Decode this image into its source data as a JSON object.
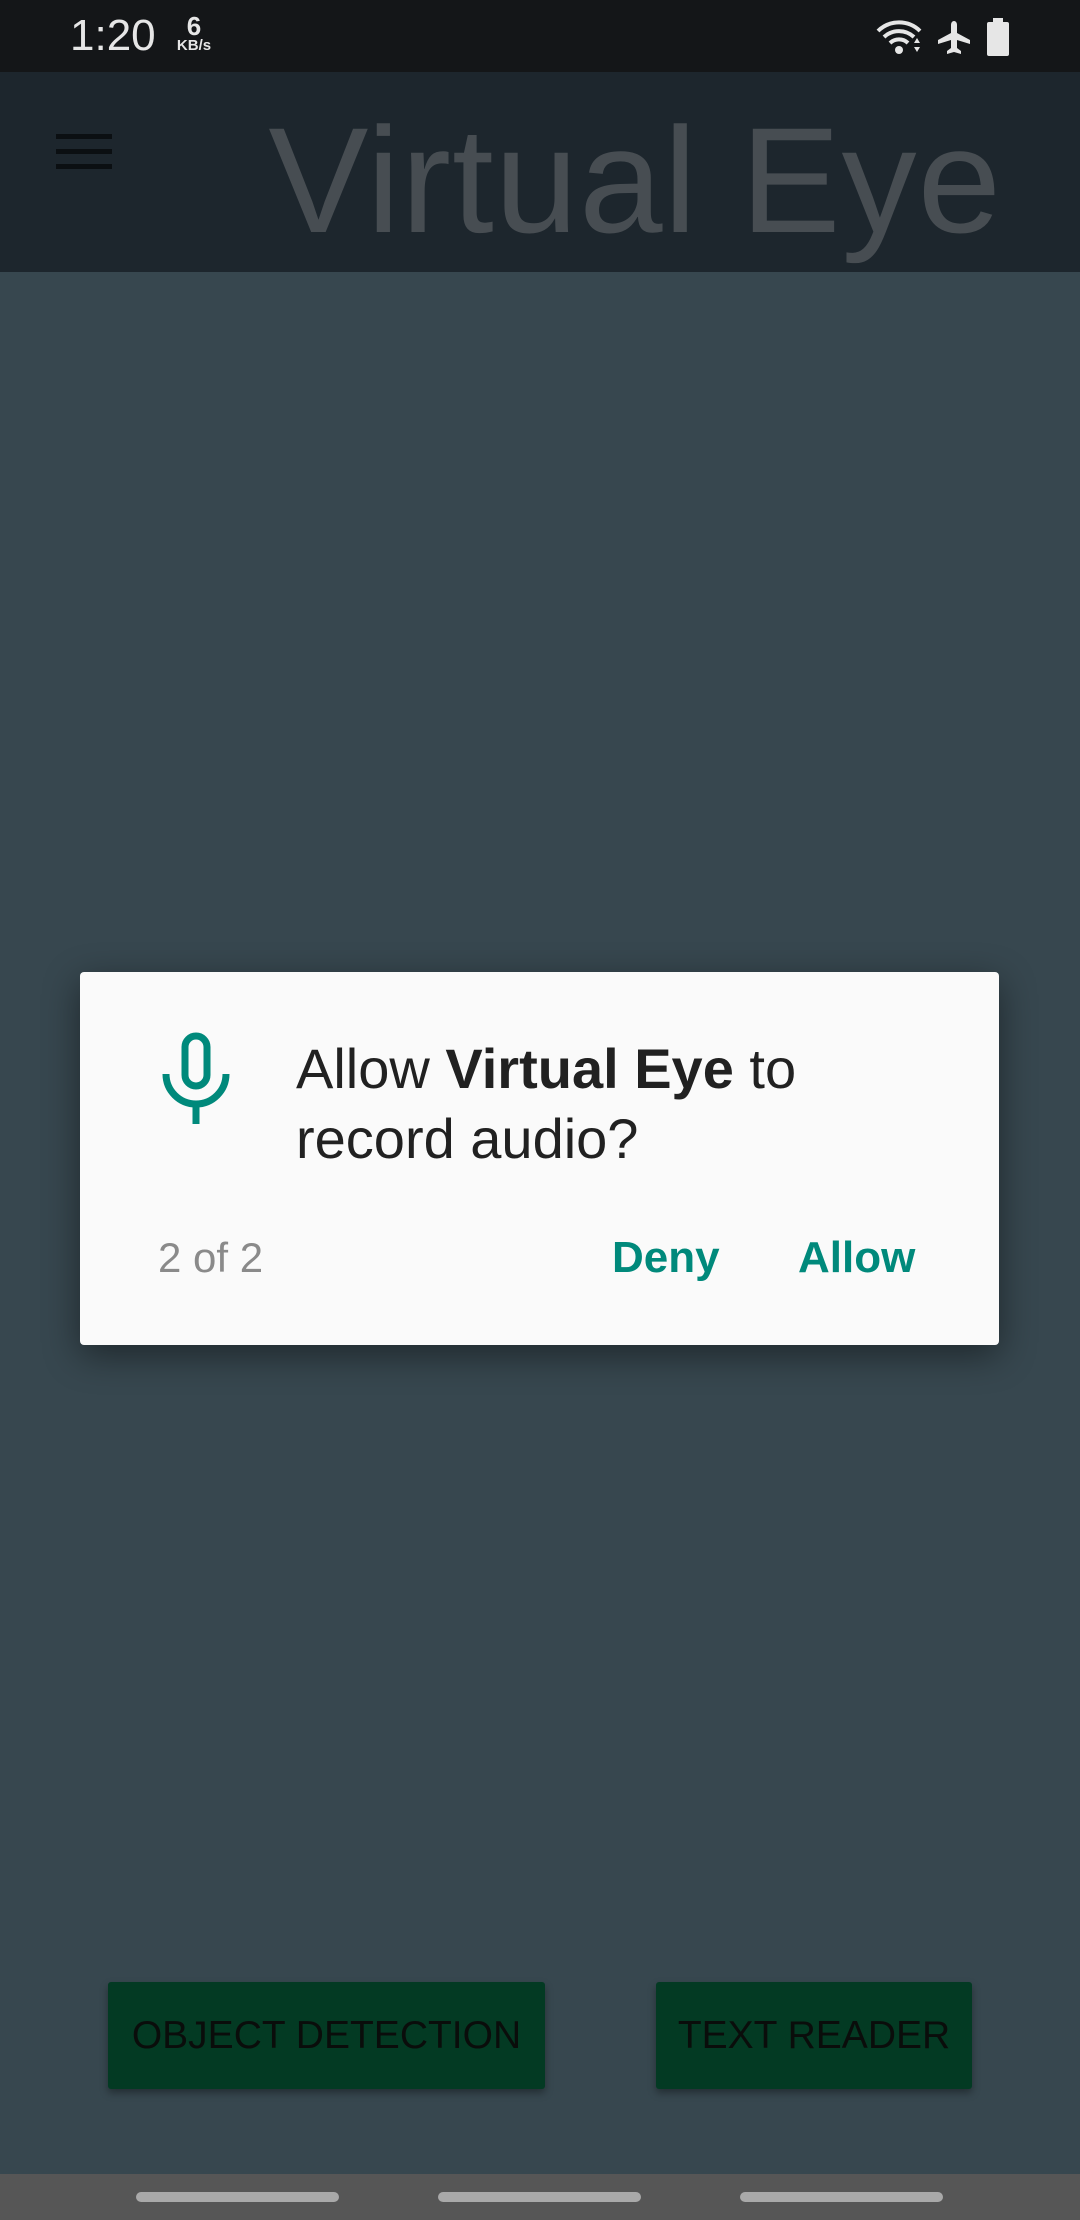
{
  "status_bar": {
    "time": "1:20",
    "net_speed_value": "6",
    "net_speed_unit": "KB/s",
    "icons": [
      "wifi-icon",
      "airplane-mode-icon",
      "battery-icon"
    ]
  },
  "app_bar": {
    "title": "Virtual Eye",
    "menu_icon": "hamburger-menu-icon"
  },
  "dialog": {
    "icon": "microphone-icon",
    "message_prefix": "Allow ",
    "app_name": "Virtual Eye",
    "message_suffix": " to record audio?",
    "counter": "2 of 2",
    "deny_label": "Deny",
    "allow_label": "Allow"
  },
  "actions": {
    "object_detection_label": "OBJECT DETECTION",
    "text_reader_label": "TEXT READER"
  },
  "colors": {
    "background": "#37474F",
    "app_bar": "#1D262D",
    "accent": "#00897B",
    "action_button": "#033A23"
  }
}
